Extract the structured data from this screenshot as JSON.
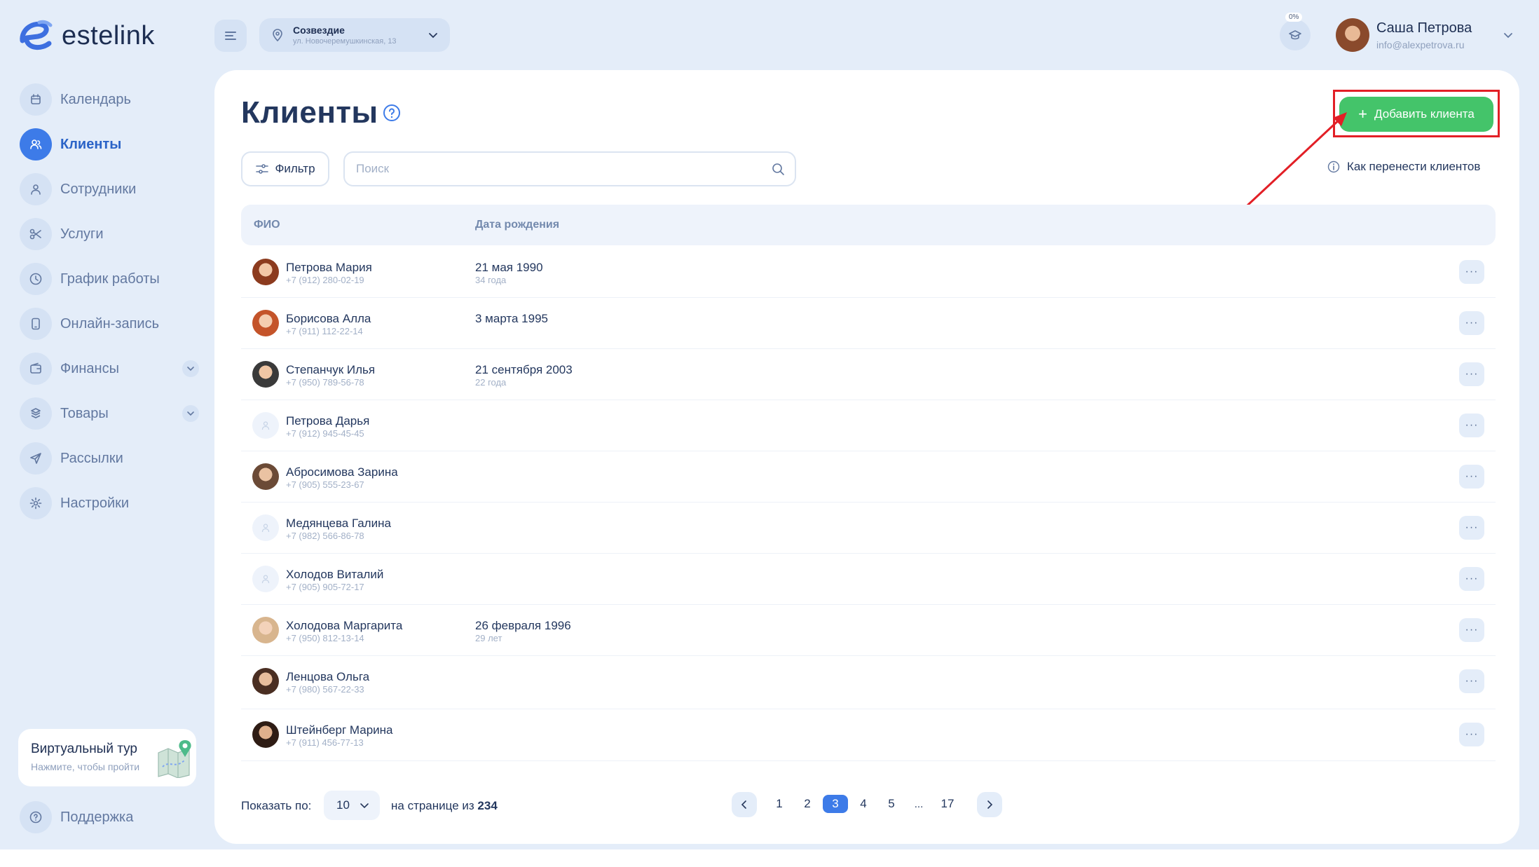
{
  "brand": {
    "name": "estelink"
  },
  "header": {
    "location": {
      "name": "Созвездие",
      "address": "ул. Новочеремушкинская, 13"
    },
    "progress": "0%",
    "user": {
      "name": "Саша Петрова",
      "email": "info@alexpetrova.ru"
    }
  },
  "sidebar": {
    "items": [
      {
        "label": "Календарь",
        "icon": "calendar-icon"
      },
      {
        "label": "Клиенты",
        "icon": "users-icon",
        "active": true
      },
      {
        "label": "Сотрудники",
        "icon": "user-icon"
      },
      {
        "label": "Услуги",
        "icon": "scissors-icon"
      },
      {
        "label": "График работы",
        "icon": "clock-icon"
      },
      {
        "label": "Онлайн-запись",
        "icon": "phone-icon"
      },
      {
        "label": "Финансы",
        "icon": "wallet-icon",
        "expandable": true
      },
      {
        "label": "Товары",
        "icon": "box-icon",
        "expandable": true
      },
      {
        "label": "Рассылки",
        "icon": "send-icon"
      },
      {
        "label": "Настройки",
        "icon": "gear-icon"
      }
    ],
    "tour": {
      "title": "Виртуальный тур",
      "subtitle": "Нажмите, чтобы пройти"
    },
    "support": "Поддержка"
  },
  "page": {
    "title": "Клиенты",
    "add_button": "Добавить клиента",
    "filter_label": "Фильтр",
    "search_placeholder": "Поиск",
    "transfer_link": "Как перенести клиентов",
    "columns": {
      "name": "ФИО",
      "dob": "Дата рождения"
    }
  },
  "clients": [
    {
      "name": "Петрова Мария",
      "phone": "+7 (912) 280-02-19",
      "dob": "21 мая 1990",
      "age": "34 года",
      "avatar": "photo"
    },
    {
      "name": "Борисова Алла",
      "phone": "+7 (911) 112-22-14",
      "dob": "3 марта 1995",
      "age": "",
      "avatar": "photo"
    },
    {
      "name": "Степанчук Илья",
      "phone": "+7 (950) 789-56-78",
      "dob": "21 сентября 2003",
      "age": "22 года",
      "avatar": "photo"
    },
    {
      "name": "Петрова Дарья",
      "phone": "+7 (912) 945-45-45",
      "dob": "",
      "age": "",
      "avatar": "empty"
    },
    {
      "name": "Абросимова Зарина",
      "phone": "+7 (905) 555-23-67",
      "dob": "",
      "age": "",
      "avatar": "photo"
    },
    {
      "name": "Медянцева Галина",
      "phone": "+7 (982) 566-86-78",
      "dob": "",
      "age": "",
      "avatar": "empty"
    },
    {
      "name": "Холодов Виталий",
      "phone": "+7 (905) 905-72-17",
      "dob": "",
      "age": "",
      "avatar": "empty"
    },
    {
      "name": "Холодова Маргарита",
      "phone": "+7 (950) 812-13-14",
      "dob": "26 февраля 1996",
      "age": "29 лет",
      "avatar": "photo"
    },
    {
      "name": "Ленцова Ольга",
      "phone": "+7 (980) 567-22-33",
      "dob": "",
      "age": "",
      "avatar": "photo"
    },
    {
      "name": "Штейнберг Марина",
      "phone": "+7 (911) 456-77-13",
      "dob": "",
      "age": "",
      "avatar": "photo"
    }
  ],
  "pagination": {
    "show_label": "Показать по:",
    "page_size": "10",
    "info_prefix": "на странице из",
    "total": "234",
    "pages": [
      "1",
      "2",
      "3",
      "4",
      "5"
    ],
    "current": "3",
    "dots": "...",
    "last": "17"
  },
  "colors": {
    "accent": "#3d7be8",
    "add_button": "#44c46a",
    "highlight_border": "#e21f26",
    "background": "#e4edf9"
  }
}
